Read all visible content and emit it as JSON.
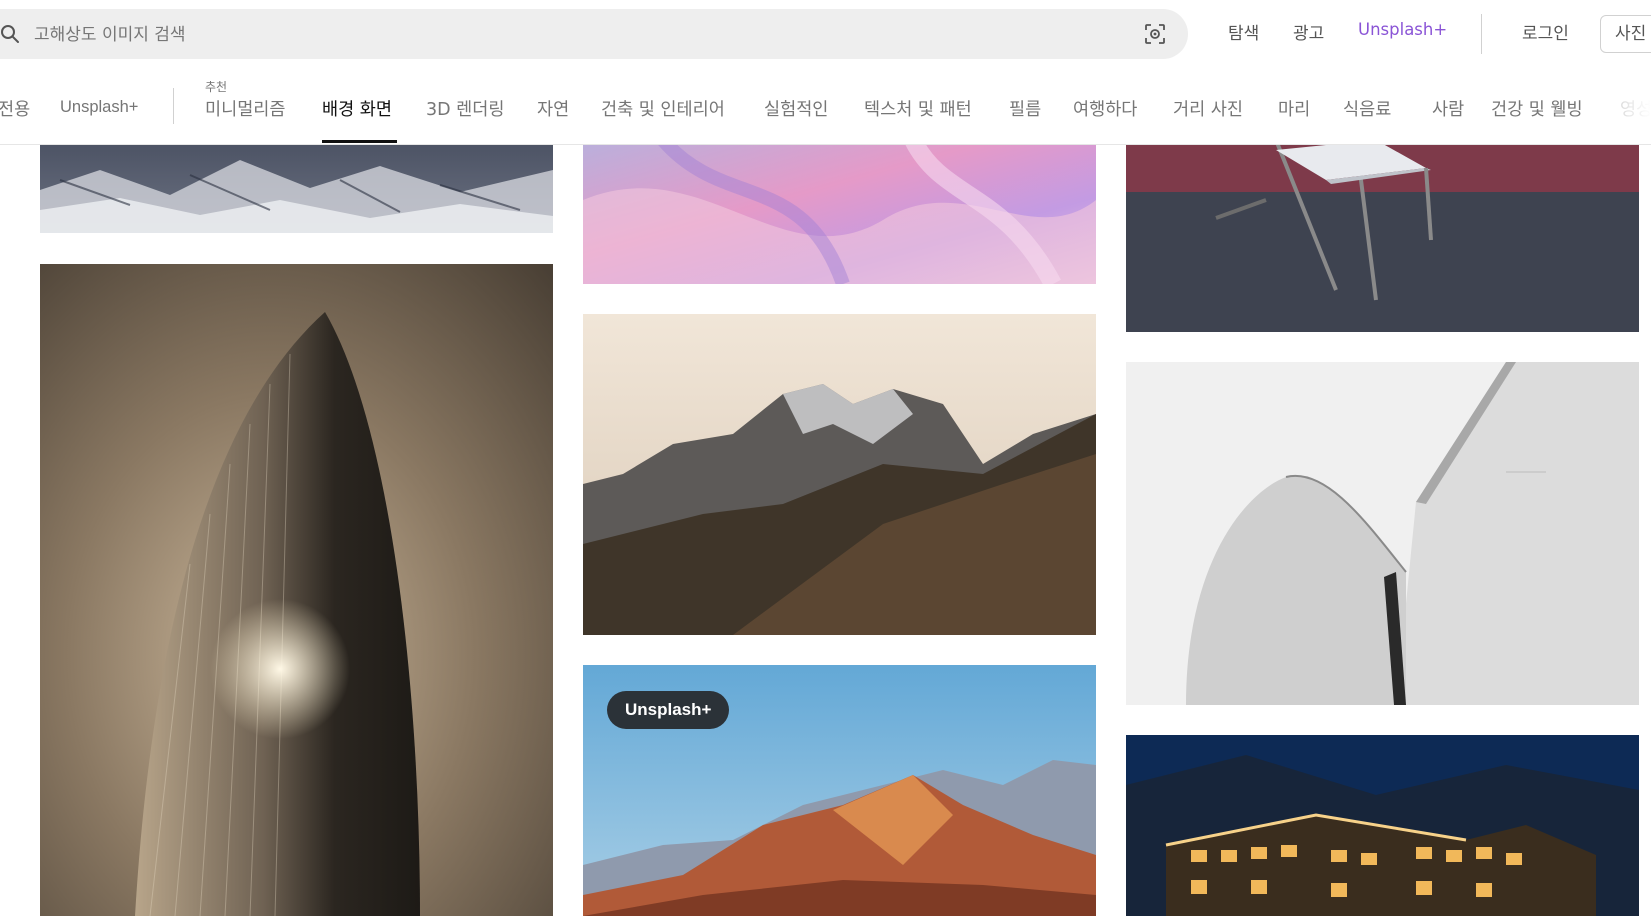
{
  "search": {
    "placeholder": "고해상도 이미지 검색"
  },
  "topnav": {
    "explore": "탐색",
    "ads": "광고",
    "plus": "Unsplash+",
    "login": "로그인",
    "submit": "사진"
  },
  "tabs": {
    "cut_first": "전용",
    "unsplash_plus": "Unsplash+",
    "featured_label": "추천",
    "items": [
      "미니멀리즘",
      "배경 화면",
      "3D 렌더링",
      "자연",
      "건축 및 인테리어",
      "실험적인",
      "텍스처 및 패턴",
      "필름",
      "여행하다",
      "거리 사진",
      "마리",
      "식음료",
      "사람",
      "건강 및 웰빙",
      "영성"
    ],
    "active": "배경 화면"
  },
  "photos": {
    "badge": "Unsplash+"
  },
  "colors": {
    "plus_accent": "#8a54d6",
    "badge_bg": "#2b3238",
    "search_bg": "#eeeeee"
  }
}
